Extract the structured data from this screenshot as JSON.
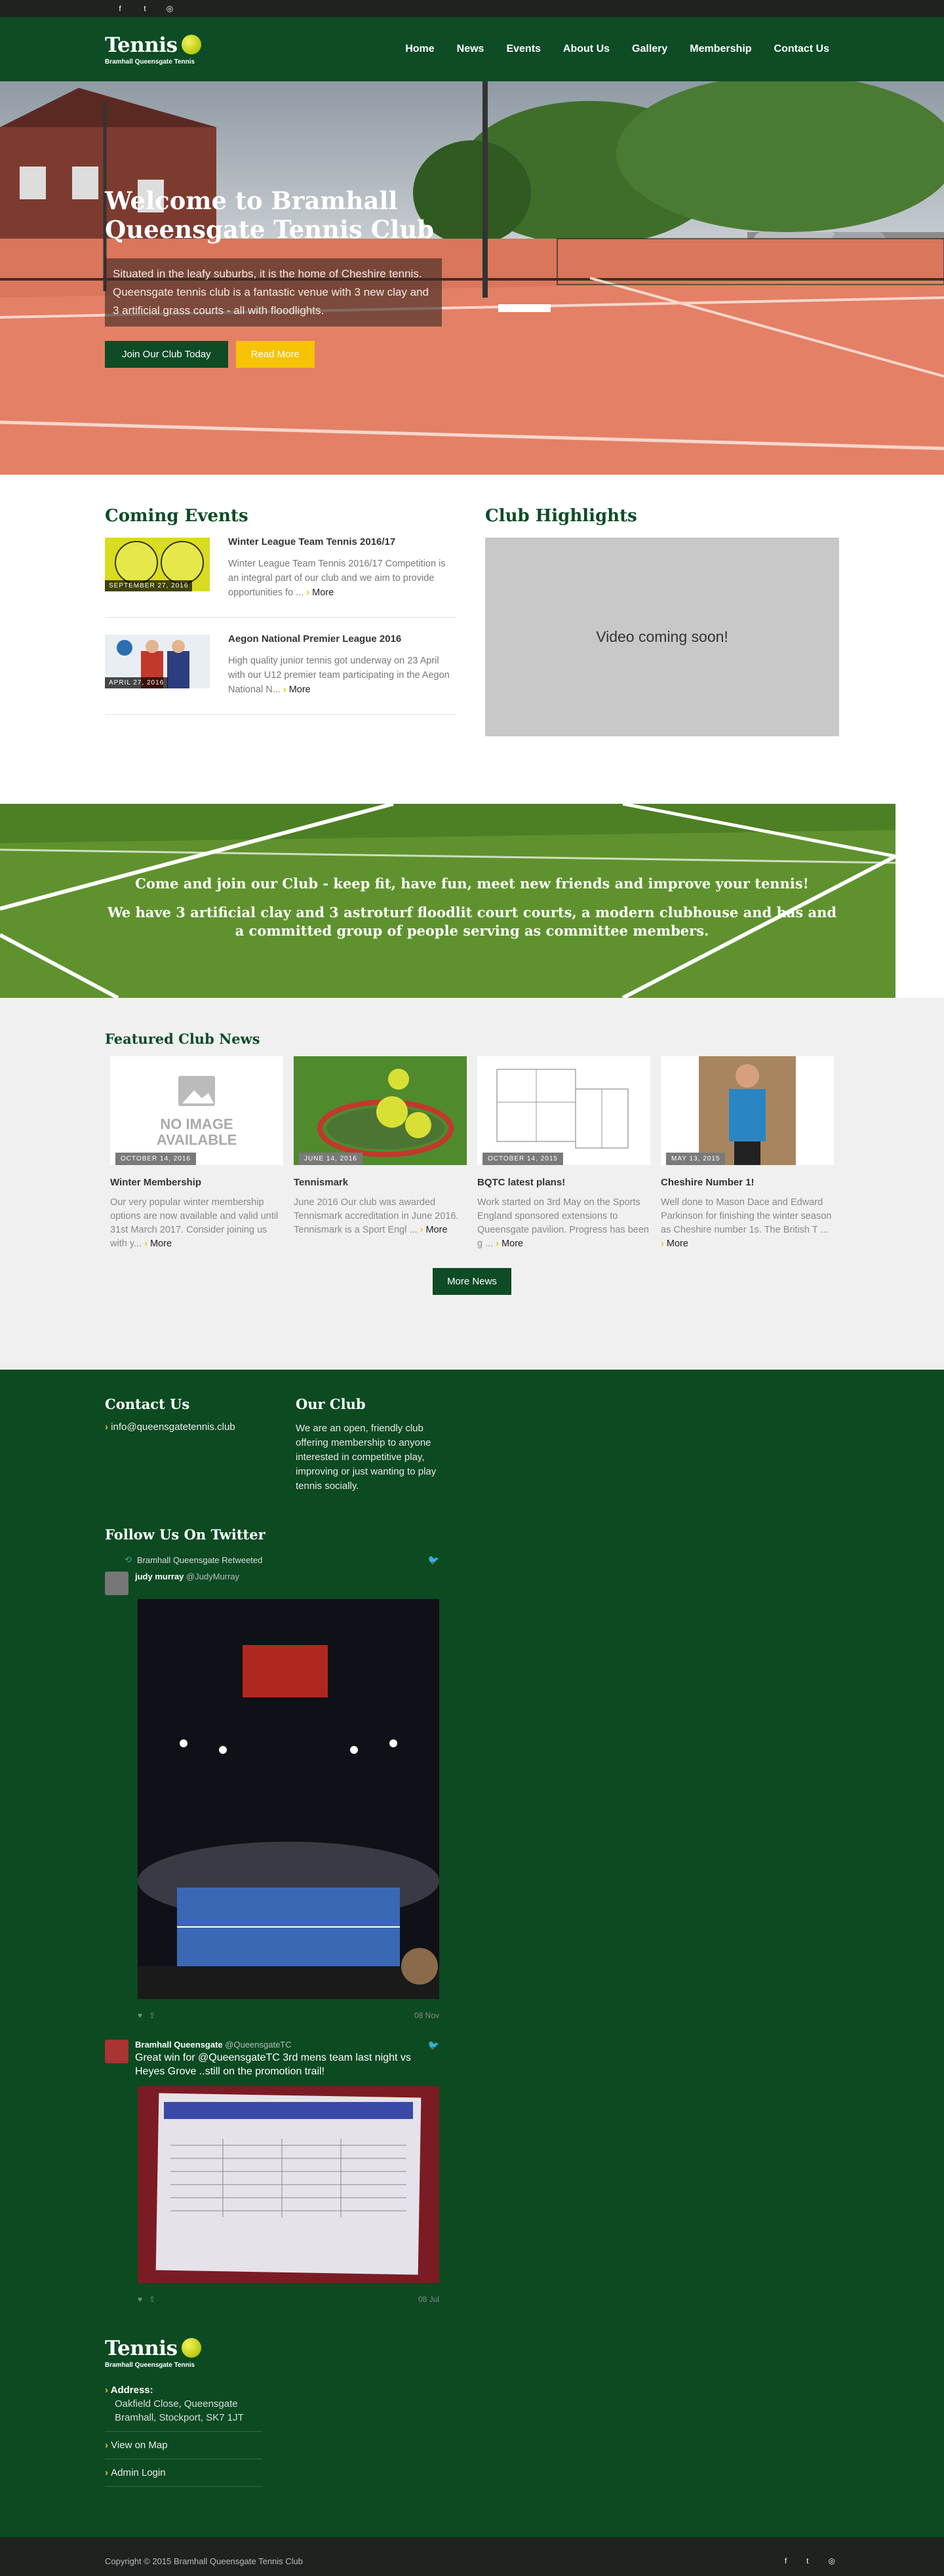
{
  "topbar": {
    "icons": [
      "facebook-icon",
      "twitter-icon",
      "instagram-icon"
    ],
    "glyphs": [
      "f",
      "t",
      "◎"
    ]
  },
  "brand": {
    "name": "Tennis",
    "tagline": "Bramhall Queensgate Tennis"
  },
  "nav": [
    "Home",
    "News",
    "Events",
    "About Us",
    "Gallery",
    "Membership",
    "Contact Us"
  ],
  "hero": {
    "title": "Welcome to Bramhall Queensgate Tennis Club",
    "text": "Situated in the leafy suburbs, it is the home of Cheshire tennis. Queensgate tennis club is a fantastic venue with 3 new clay and 3 artificial grass courts - all with floodlights.",
    "join": "Join Our Club Today",
    "read": "Read More"
  },
  "events": {
    "title": "Coming Events",
    "items": [
      {
        "title": "Winter League Team Tennis 2016/17",
        "date": "SEPTEMBER 27, 2016",
        "text": "Winter League Team Tennis 2016/17 Competition is an integral part of our club and we aim to provide opportunities fo ...",
        "more": "More"
      },
      {
        "title": "Aegon National Premier League 2016",
        "date": "APRIL 27, 2016",
        "text": "High quality junior tennis got underway on 23 April with our U12 premier team participating in the Aegon National N...",
        "more": "More"
      }
    ]
  },
  "highlights": {
    "title": "Club Highlights",
    "video": "Video coming soon!"
  },
  "banner": {
    "line1": "Come and join our Club - keep fit, have fun, meet new friends and improve your tennis!",
    "line2": "We have 3 artificial clay and 3 astroturf floodlit court courts, a modern clubhouse and has and a committed group of people serving as committee members."
  },
  "news": {
    "title": "Featured Club News",
    "button": "More News",
    "no_image": "NO IMAGE AVAILABLE",
    "cards": [
      {
        "date": "OCTOBER 14, 2016",
        "title": "Winter Membership",
        "text": "Our very popular winter membership options are now available and valid until 31st March 2017. Consider joining us with y...",
        "more": "More"
      },
      {
        "date": "JUNE 14, 2016",
        "title": "Tennismark",
        "text": "June 2016 Our club was awarded Tennismark accreditation in June 2016. Tennismark is a Sport Engl ...",
        "more": "More"
      },
      {
        "date": "OCTOBER 14, 2015",
        "title": "BQTC latest plans!",
        "text": "Work started on 3rd May on the Sports England sponsored extensions to Queensgate pavilion. Progress has been g ...",
        "more": "More"
      },
      {
        "date": "MAY 13, 2015",
        "title": "Cheshire Number 1!",
        "text": "Well done to Mason Dace and Edward Parkinson for finishing the winter season as Cheshire number 1s. The British T ...",
        "more": "More"
      }
    ]
  },
  "footer": {
    "contact_title": "Contact Us",
    "email": "info@queensgatetennis.club",
    "club_title": "Our Club",
    "club_text": "We are an open, friendly club offering membership to anyone interested in competitive play, improving or just wanting to play tennis socially.",
    "twitter_title": "Follow Us On Twitter",
    "tweets": [
      {
        "retweet": "Bramhall Queensgate Retweeted",
        "name": "judy murray",
        "handle": "@JudyMurray",
        "text": "",
        "time": "08 Nov"
      },
      {
        "retweet": "",
        "name": "Bramhall Queensgate",
        "handle": "@QueensgateTC",
        "text": "Great win for @QueensgateTC 3rd mens team last night vs Heyes Grove ..still on the promotion trail!",
        "time": "08 Jul"
      }
    ],
    "address_label": "Address:",
    "address": "Oakfield Close, Queensgate Bramhall, Stockport, SK7 1JT",
    "map": "View on Map",
    "admin": "Admin Login"
  },
  "bottom": {
    "copyright": "Copyright © 2015 Bramhall Queensgate Tennis Club"
  }
}
